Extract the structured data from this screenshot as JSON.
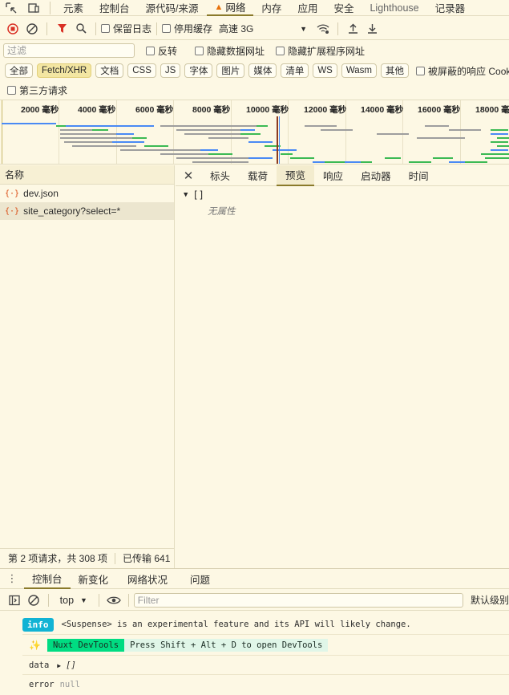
{
  "top_tabs": {
    "items": [
      "元素",
      "控制台",
      "源代码/来源",
      "网络",
      "内存",
      "应用",
      "安全",
      "Lighthouse",
      "记录器"
    ],
    "active_index": 3
  },
  "toolbar": {
    "preserve_log": "保留日志",
    "disable_cache": "停用缓存",
    "throttle": "高速 3G"
  },
  "filter": {
    "placeholder": "过滤",
    "invert": "反转",
    "hide_data_urls": "隐藏数据网址",
    "hide_extension_urls": "隐藏扩展程序网址"
  },
  "type_filters": {
    "items": [
      "全部",
      "Fetch/XHR",
      "文档",
      "CSS",
      "JS",
      "字体",
      "图片",
      "媒体",
      "清单",
      "WS",
      "Wasm",
      "其他"
    ],
    "active_index": 1,
    "blocked_responses": "被屏蔽的响应 Cookie",
    "third_party": "第三方请求"
  },
  "timeline": {
    "ticks": [
      "2000 毫秒",
      "4000 毫秒",
      "6000 毫秒",
      "8000 毫秒",
      "10000 毫秒",
      "12000 毫秒",
      "14000 毫秒",
      "16000 毫秒",
      "18000 毫秒"
    ],
    "colors": {
      "blue": "#4a8af4",
      "green": "#3cba54",
      "gray": "#9e9e9e",
      "red": "#c0392b"
    }
  },
  "requests": {
    "header": "名称",
    "rows": [
      {
        "name": "dev.json",
        "selected": false
      },
      {
        "name": "site_category?select=*",
        "selected": true
      }
    ],
    "status": "第 2 项请求，共 308 项",
    "transferred": "已传输 641"
  },
  "detail": {
    "tabs": [
      "标头",
      "载荷",
      "预览",
      "响应",
      "启动器",
      "时间"
    ],
    "active_index": 2,
    "preview_root": "[]",
    "no_properties": "无属性"
  },
  "drawer": {
    "tabs": [
      "控制台",
      "新变化",
      "网络状况",
      "问题"
    ],
    "active_index": 0
  },
  "console": {
    "context": "top",
    "filter_placeholder": "Filter",
    "level": "默认级别",
    "messages": {
      "info_badge": "info",
      "info_text": "<Suspense> is an experimental feature and its API will likely change.",
      "nuxt_badge": "Nuxt DevTools",
      "nuxt_text": "Press Shift + Alt + D to open DevTools",
      "data_key": "data",
      "data_value": "[]",
      "error_key": "error",
      "error_value": "null"
    }
  }
}
